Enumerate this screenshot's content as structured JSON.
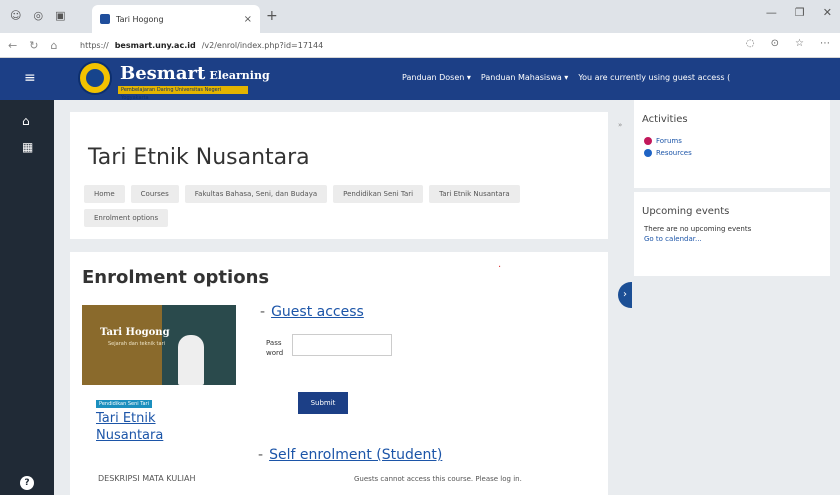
{
  "browser": {
    "tab_title": "Tari Hogong",
    "tab_close": "×",
    "new_tab": "+",
    "url_prefix": "https://",
    "url_host": "besmart.uny.ac.id",
    "url_path": "/v2/enrol/index.php?id=17144"
  },
  "header": {
    "brand_name": "Besmart",
    "brand_suffix": "Elearning",
    "brand_tagline": "Pembelajaran Daring Universitas Negeri Yogyakarta",
    "nav": [
      "Panduan Dosen ▾",
      "Panduan Mahasiswa ▾",
      "You are currently using guest access ("
    ]
  },
  "page": {
    "title": "Tari Etnik Nusantara",
    "breadcrumbs": [
      "Home",
      "Courses",
      "Fakultas Bahasa, Seni, dan Budaya",
      "Pendidikan Seni Tari",
      "Tari Etnik Nusantara",
      "Enrolment options"
    ]
  },
  "enrol": {
    "title": "Enrolment options",
    "course_image_title": "Tari Hogong",
    "course_image_subtitle": "Sejarah dan teknik tari",
    "category_badge": "Pendidikan Seni Tari",
    "course_name": "Tari Etnik Nusantara",
    "description_label": "DESKRIPSI MATA KULIAH",
    "guest_heading": "Guest access",
    "password_label": "Pass word",
    "submit_label": "Submit",
    "self_heading": "Self enrolment (Student)",
    "self_note": "Guests cannot access this course. Please log in."
  },
  "blocks": {
    "activities_title": "Activities",
    "activities": [
      {
        "label": "Forums",
        "color": "#c2185b"
      },
      {
        "label": "Resources",
        "color": "#1e63c4"
      }
    ],
    "events_title": "Upcoming events",
    "events_text": "There are no upcoming events",
    "events_link": "Go to calendar..."
  }
}
